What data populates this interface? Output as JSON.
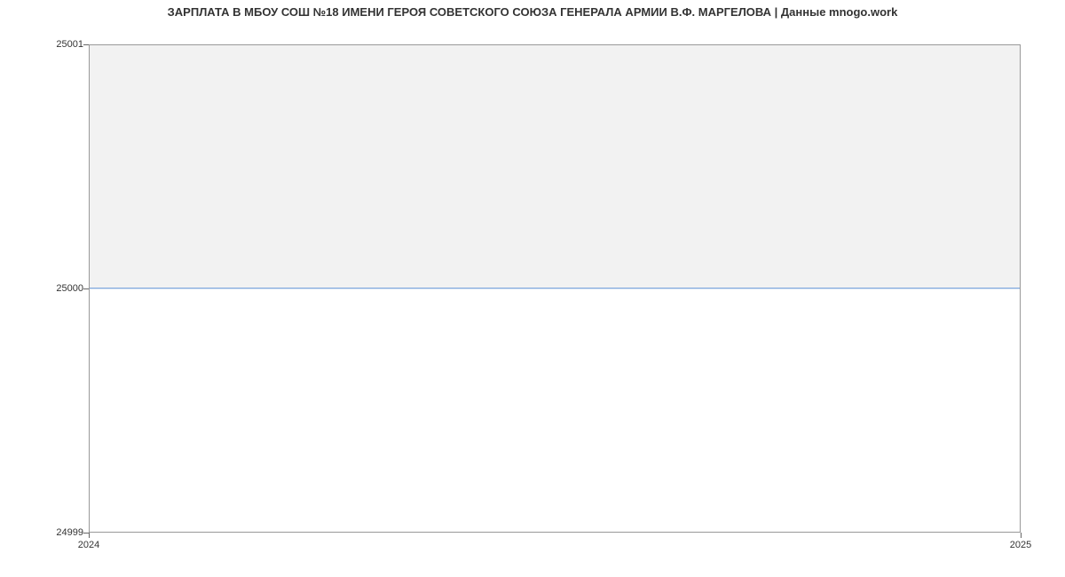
{
  "chart_data": {
    "type": "line",
    "title": "ЗАРПЛАТА В МБОУ СОШ №18 ИМЕНИ ГЕРОЯ СОВЕТСКОГО СОЮЗА ГЕНЕРАЛА АРМИИ В.Ф. МАРГЕЛОВА | Данные mnogo.work",
    "x": [
      "2024",
      "2025"
    ],
    "values": [
      25000,
      25000
    ],
    "xlabel": "",
    "ylabel": "",
    "ylim": [
      24999,
      25001
    ],
    "y_ticks": [
      "24999",
      "25000",
      "25001"
    ],
    "x_ticks": [
      "2024",
      "2025"
    ],
    "line_color": "#5b8fd6",
    "fill_color_above": "#f2f2f2"
  }
}
